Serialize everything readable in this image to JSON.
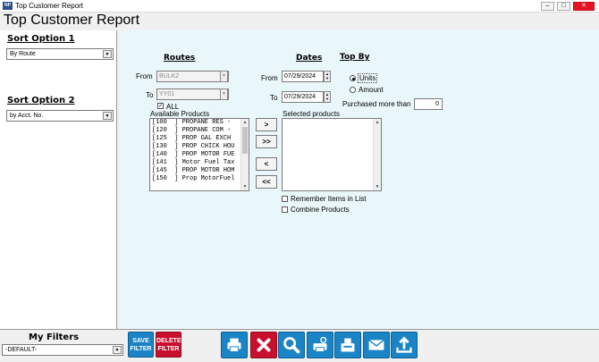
{
  "window": {
    "title": "Top Customer Report",
    "icon_label": "NP"
  },
  "header": {
    "title": "Top Customer Report"
  },
  "sidebar": {
    "sort1": {
      "label": "Sort Option 1",
      "value": "By Route"
    },
    "sort2": {
      "label": "Sort Option 2",
      "value": "by Acct. No."
    }
  },
  "routes": {
    "title": "Routes",
    "from_label": "From",
    "from_value": "BULK2",
    "to_label": "To",
    "to_value": "YY01",
    "all_label": "ALL",
    "all_checked": true
  },
  "products": {
    "available_label": "Available Products",
    "items": [
      "[100  ] PROPANE RES -",
      "[120  ] PROPANE COM -",
      "[125  ] PROP GAL EXCH",
      "[130  ] PROP CHICK HOU",
      "[140  ] PROP MOTOR FUE",
      "[141  ] Motor Fuel Tax",
      "[145  ] PROP MOTOR HOM",
      "[150  ] Prop MotorFuel"
    ],
    "selected_label": "Selected products",
    "move_buttons": [
      ">",
      ">>",
      "<",
      "<<"
    ],
    "remember_label": "Remember Items in List",
    "combine_label": "Combine Products"
  },
  "dates": {
    "title": "Dates",
    "from_label": "From",
    "from_value": "07/29/2024",
    "to_label": "To",
    "to_value": "07/29/2024"
  },
  "topby": {
    "title": "Top By",
    "units_label": "Units",
    "amount_label": "Amount",
    "selected": "Units",
    "purchased_label": "Purchased more than",
    "purchased_value": "0"
  },
  "footer": {
    "filters_label": "My Filters",
    "filter_value": "-DEFAULT-",
    "save_filter_label": "SAVE FILTER",
    "delete_filter_label": "DELETE FILTER"
  },
  "toolbar_icons": [
    "printer-icon",
    "close-x-icon",
    "search-icon",
    "print-preview-icon",
    "fax-icon",
    "email-icon",
    "export-icon"
  ],
  "colors": {
    "accent_blue": "#1a84c6",
    "delete_red": "#c8102e",
    "panel_bg": "#eaf7fa"
  }
}
